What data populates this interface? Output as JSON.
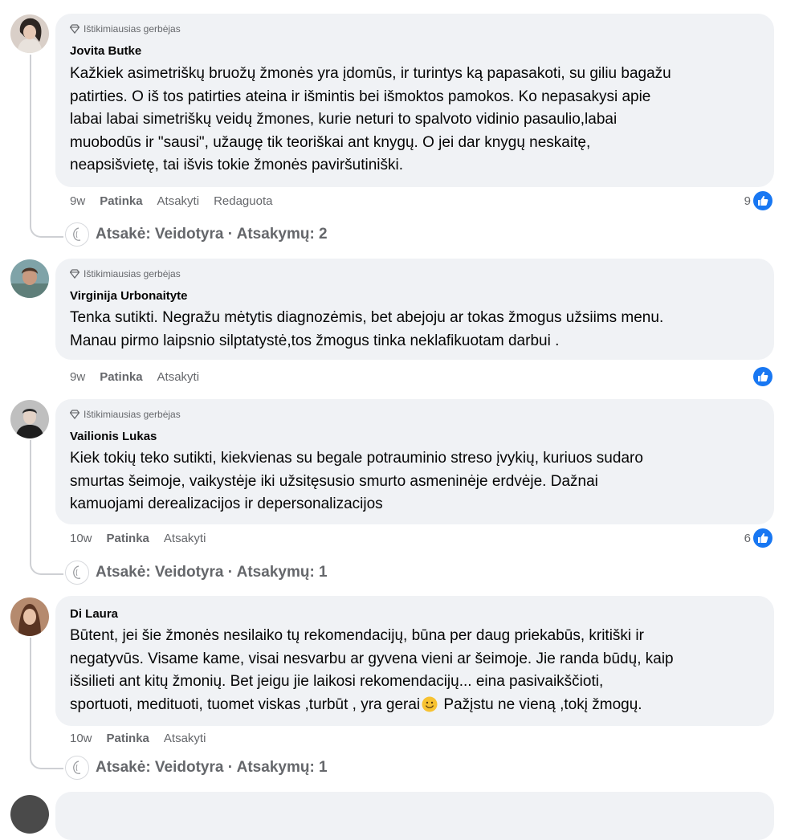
{
  "comments": [
    {
      "badge": "Ištikimiausias gerbėjas",
      "author": "Jovita Butke",
      "lines": [
        "Kažkiek asimetriškų bruožų žmonės yra įdomūs, ir turintys ką papasakoti, su giliu bagažu",
        "patirties. O iš tos patirties ateina ir išmintis bei išmoktos pamokos. Ko nepasakysi apie",
        "labai labai simetriškų veidų žmones, kurie neturi to spalvoto vidinio pasaulio,labai",
        "muobodūs ir \"sausi\", užaugę tik teoriškai ant knygų. O jei dar knygų neskaitę,",
        "neapsišvietę, tai išvis tokie žmonės paviršutiniški."
      ],
      "time": "9w",
      "like_label": "Patinka",
      "reply_label": "Atsakyti",
      "edited_label": "Redaguota",
      "reaction_count": "9",
      "replies_summary": "Atsakė: Veidotyra · Atsakymų: 2"
    },
    {
      "badge": "Ištikimiausias gerbėjas",
      "author": "Virginija Urbonaityte",
      "lines": [
        "Tenka sutikti. Negražu mėtytis diagnozėmis, bet abejoju ar tokas žmogus užsiims menu.",
        "Manau pirmo laipsnio silptatystė,tos žmogus tinka neklafikuotam darbui ."
      ],
      "time": "9w",
      "like_label": "Patinka",
      "reply_label": "Atsakyti",
      "reaction_count": ""
    },
    {
      "badge": "Ištikimiausias gerbėjas",
      "author": "Vailionis Lukas",
      "lines": [
        "Kiek tokių teko sutikti, kiekvienas su begale potrauminio streso įvykių, kuriuos sudaro",
        "smurtas šeimoje, vaikystėje iki užsitęsusio smurto asmeninėje erdvėje. Dažnai",
        "kamuojami derealizacijos ir depersonalizacijos"
      ],
      "time": "10w",
      "like_label": "Patinka",
      "reply_label": "Atsakyti",
      "reaction_count": "6",
      "replies_summary": "Atsakė: Veidotyra · Atsakymų: 1"
    },
    {
      "author": "Di Laura",
      "lines": [
        "Būtent, jei šie žmonės nesilaiko tų rekomendacijų, būna per daug priekabūs, kritiški ir",
        "negatyvūs. Visame kame, visai nesvarbu ar gyvena vieni ar šeimoje. Jie randa būdų, kaip",
        "išsilieti ant kitų žmonių. Bet jeigu jie laikosi rekomendacijų... eina pasivaikščioti,"
      ],
      "last_line_before_emoji": "sportuoti, medituoti, tuomet viskas ,turbūt , yra gerai",
      "last_line_after_emoji": " Pažįstu ne vieną ,tokį žmogų.",
      "emoji_name": "smiling-face-emoji",
      "time": "10w",
      "like_label": "Patinka",
      "reply_label": "Atsakyti",
      "replies_summary": "Atsakė: Veidotyra · Atsakymų: 1"
    }
  ],
  "icons": {
    "badge": "diamond-icon",
    "like": "like-thumb-icon",
    "reply_avatar": "veidotyra-avatar-icon"
  },
  "colors": {
    "like_blue": "#1877f2",
    "bubble_bg": "#f0f2f5",
    "meta_gray": "#65676b"
  }
}
